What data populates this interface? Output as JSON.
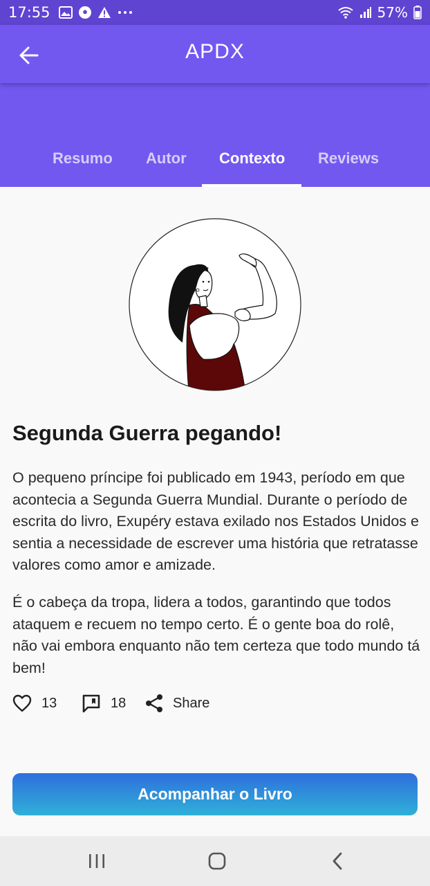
{
  "status_bar": {
    "time": "17:55",
    "battery": "57%",
    "icons": [
      "image-icon",
      "soccer-ball-icon",
      "warning-icon",
      "more-dots-icon",
      "wifi-icon",
      "signal-icon",
      "battery-icon"
    ]
  },
  "app_bar": {
    "title": "APDX",
    "back_icon": "arrow-back-icon"
  },
  "tabs": [
    {
      "label": "Resumo",
      "active": false
    },
    {
      "label": "Autor",
      "active": false
    },
    {
      "label": "Contexto",
      "active": true
    },
    {
      "label": "Reviews",
      "active": false
    }
  ],
  "article": {
    "title": "Segunda Guerra pegando!",
    "paragraphs": [
      "O pequeno príncipe foi publicado em 1943, período em que acontecia a Segunda Guerra Mundial. Durante o período de escrita do livro, Exupéry estava exilado nos Estados Unidos e sentia a necessidade de escrever uma história que retratasse valores como amor e amizade.",
      "É o cabeça da tropa, lidera a todos, garantindo que todos ataquem e recuem no tempo certo. É o gente boa do rolê, não vai embora enquanto não tem certeza que todo mundo tá bem!"
    ]
  },
  "actions": {
    "likes": "13",
    "comments": "18",
    "share_label": "Share"
  },
  "cta": {
    "label": "Acompanhar o Livro"
  },
  "colors": {
    "status_bar": "#5e44d1",
    "primary": "#7358f0",
    "button_top": "#2f6fdc",
    "button_bottom": "#2fb0d9"
  }
}
